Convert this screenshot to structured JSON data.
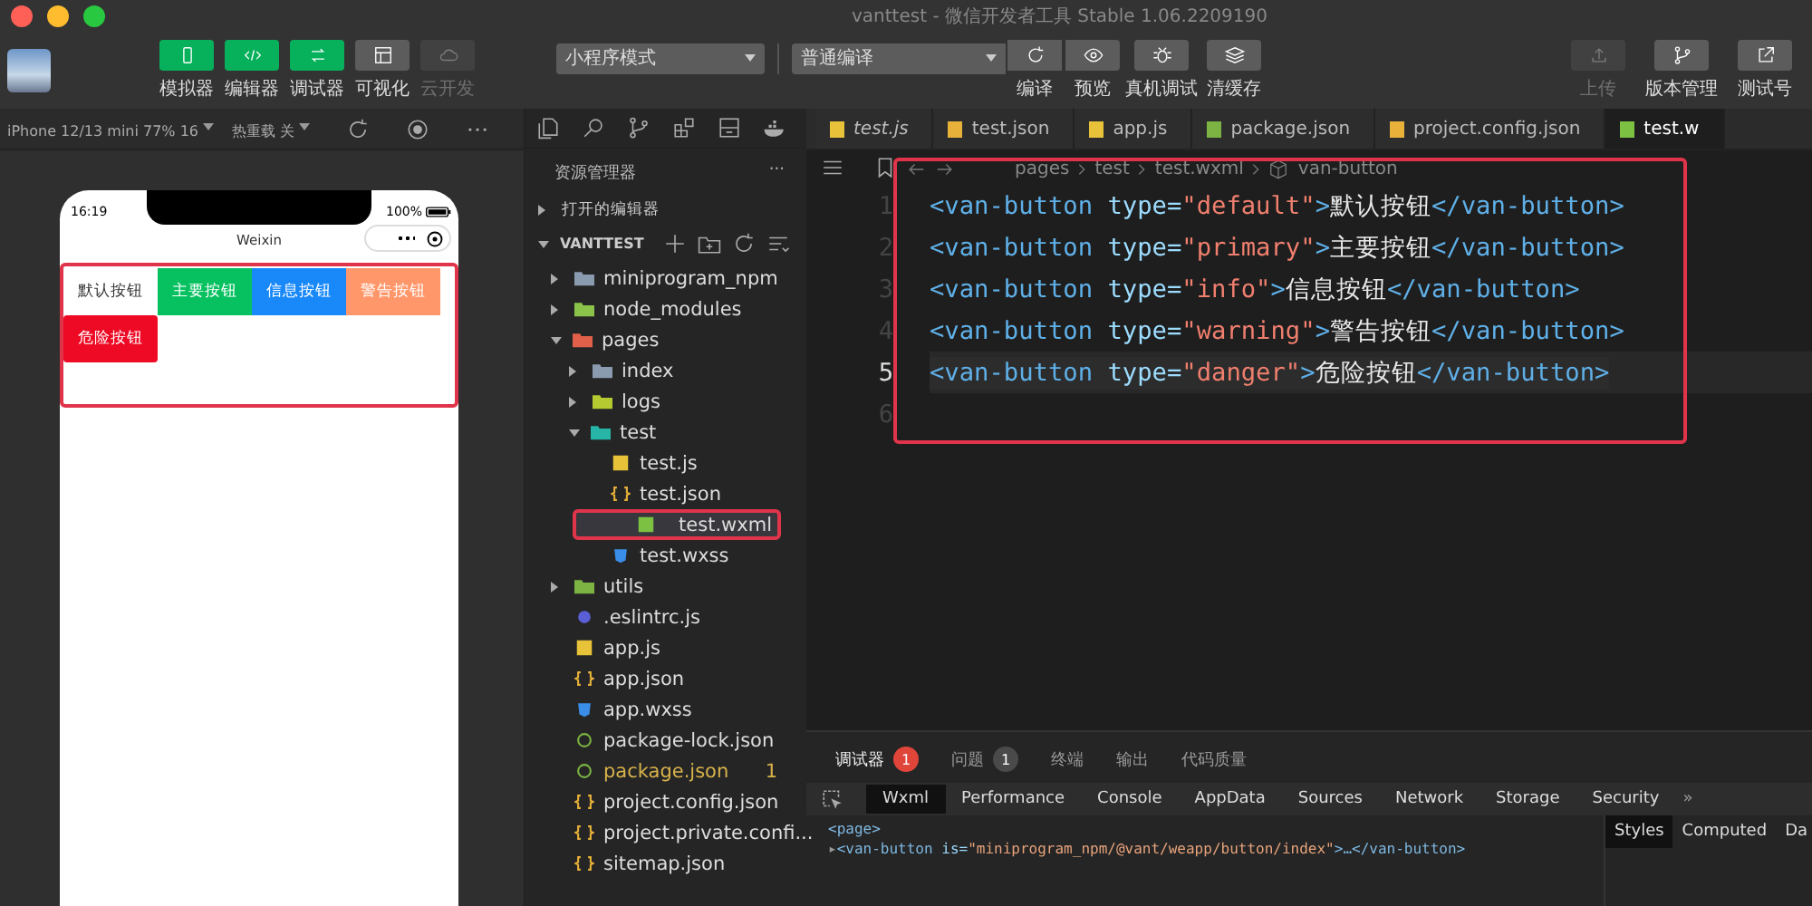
{
  "window": {
    "title": "vanttest - 微信开发者工具 Stable 1.06.2209190"
  },
  "toolbar": {
    "view_buttons": [
      {
        "label": "模拟器",
        "on": true,
        "disabled": false
      },
      {
        "label": "编辑器",
        "on": true,
        "disabled": false
      },
      {
        "label": "调试器",
        "on": true,
        "disabled": false
      },
      {
        "label": "可视化",
        "on": false,
        "disabled": false
      },
      {
        "label": "云开发",
        "on": false,
        "disabled": true
      }
    ],
    "mode_select": {
      "value": "小程序模式"
    },
    "compile_select": {
      "value": "普通编译"
    },
    "actions": [
      {
        "label": "编译"
      },
      {
        "label": "预览"
      },
      {
        "label": "真机调试"
      },
      {
        "label": "清缓存"
      }
    ],
    "right_actions": [
      {
        "label": "上传",
        "disabled": true
      },
      {
        "label": "版本管理",
        "disabled": false
      },
      {
        "label": "测试号",
        "disabled": false
      }
    ]
  },
  "simulator": {
    "device": "iPhone 12/13 mini 77% 16",
    "hot_reload": "热重载 关",
    "phone": {
      "time": "16:19",
      "battery": "100%",
      "nav_title": "Weixin",
      "buttons": [
        {
          "label": "默认按钮",
          "kind": "default"
        },
        {
          "label": "主要按钮",
          "kind": "primary"
        },
        {
          "label": "信息按钮",
          "kind": "info"
        },
        {
          "label": "警告按钮",
          "kind": "warning"
        },
        {
          "label": "危险按钮",
          "kind": "danger"
        }
      ]
    }
  },
  "explorer": {
    "title": "资源管理器",
    "more": "···",
    "sections": [
      {
        "label": "打开的编辑器",
        "expanded": false
      },
      {
        "label": "VANTTEST",
        "expanded": true
      }
    ],
    "tree": [
      {
        "name": "miniprogram_npm",
        "kind": "folder",
        "color": "#8a9bb0",
        "expanded": false,
        "selected": false,
        "modified": false
      },
      {
        "name": "node_modules",
        "kind": "folder",
        "color": "#8bc34a",
        "expanded": false,
        "selected": false,
        "modified": false
      },
      {
        "name": "pages",
        "kind": "folder",
        "color": "#e0604a",
        "expanded": true,
        "selected": false,
        "modified": false,
        "children": [
          {
            "name": "index",
            "kind": "folder",
            "color": "#8a9bb0",
            "expanded": false,
            "selected": false,
            "modified": false
          },
          {
            "name": "logs",
            "kind": "folder",
            "color": "#b5c930",
            "expanded": false,
            "selected": false,
            "modified": false
          },
          {
            "name": "test",
            "kind": "folder",
            "color": "#26b5a6",
            "expanded": true,
            "selected": false,
            "modified": false,
            "children": [
              {
                "name": "test.js",
                "kind": "js",
                "selected": false,
                "modified": false
              },
              {
                "name": "test.json",
                "kind": "json",
                "selected": false,
                "modified": false
              },
              {
                "name": "test.wxml",
                "kind": "wxml",
                "selected": true,
                "modified": false
              },
              {
                "name": "test.wxss",
                "kind": "wxss",
                "selected": false,
                "modified": false
              }
            ]
          }
        ]
      },
      {
        "name": "utils",
        "kind": "folder",
        "color": "#7cb342",
        "expanded": false,
        "selected": false,
        "modified": false
      },
      {
        "name": ".eslintrc.js",
        "kind": "eslint",
        "selected": false,
        "modified": false
      },
      {
        "name": "app.js",
        "kind": "js",
        "selected": false,
        "modified": false
      },
      {
        "name": "app.json",
        "kind": "json",
        "selected": false,
        "modified": false
      },
      {
        "name": "app.wxss",
        "kind": "wxss",
        "selected": false,
        "modified": false
      },
      {
        "name": "package-lock.json",
        "kind": "npm",
        "selected": false,
        "modified": false
      },
      {
        "name": "package.json",
        "kind": "npm",
        "selected": false,
        "modified": true,
        "badge": "1"
      },
      {
        "name": "project.config.json",
        "kind": "json",
        "selected": false,
        "modified": false
      },
      {
        "name": "project.private.confi...",
        "kind": "json",
        "selected": false,
        "modified": false
      },
      {
        "name": "sitemap.json",
        "kind": "json",
        "selected": false,
        "modified": false
      }
    ]
  },
  "editor": {
    "tabs": [
      {
        "label": "test.js",
        "kind": "js",
        "preview": true,
        "selected": false
      },
      {
        "label": "test.json",
        "kind": "json",
        "preview": false,
        "selected": false
      },
      {
        "label": "app.js",
        "kind": "js",
        "preview": false,
        "selected": false
      },
      {
        "label": "package.json",
        "kind": "npm",
        "preview": false,
        "selected": false
      },
      {
        "label": "project.config.json",
        "kind": "json",
        "preview": false,
        "selected": false
      },
      {
        "label": "test.w",
        "kind": "wxml",
        "preview": false,
        "selected": true
      }
    ],
    "breadcrumb": [
      "pages",
      "test",
      "test.wxml",
      "van-button"
    ],
    "lines": [
      {
        "number": "1",
        "active": false,
        "tokens": [
          {
            "kind": "tag",
            "text": "<van-button"
          },
          {
            "kind": "attr",
            "text": " type="
          },
          {
            "kind": "string",
            "text": "\"default\""
          },
          {
            "kind": "tag",
            "text": ">"
          },
          {
            "kind": "text",
            "text": "默认按钮"
          },
          {
            "kind": "tag",
            "text": "</van-button>"
          }
        ]
      },
      {
        "number": "2",
        "active": false,
        "tokens": [
          {
            "kind": "tag",
            "text": "<van-button"
          },
          {
            "kind": "attr",
            "text": " type="
          },
          {
            "kind": "string",
            "text": "\"primary\""
          },
          {
            "kind": "tag",
            "text": ">"
          },
          {
            "kind": "text",
            "text": "主要按钮"
          },
          {
            "kind": "tag",
            "text": "</van-button>"
          }
        ]
      },
      {
        "number": "3",
        "active": false,
        "tokens": [
          {
            "kind": "tag",
            "text": "<van-button"
          },
          {
            "kind": "attr",
            "text": " type="
          },
          {
            "kind": "string",
            "text": "\"info\""
          },
          {
            "kind": "tag",
            "text": ">"
          },
          {
            "kind": "text",
            "text": "信息按钮"
          },
          {
            "kind": "tag",
            "text": "</van-button>"
          }
        ]
      },
      {
        "number": "4",
        "active": false,
        "tokens": [
          {
            "kind": "tag",
            "text": "<van-button"
          },
          {
            "kind": "attr",
            "text": " type="
          },
          {
            "kind": "string",
            "text": "\"warning\""
          },
          {
            "kind": "tag",
            "text": ">"
          },
          {
            "kind": "text",
            "text": "警告按钮"
          },
          {
            "kind": "tag",
            "text": "</van-button>"
          }
        ]
      },
      {
        "number": "5",
        "active": true,
        "tokens": [
          {
            "kind": "tag",
            "text": "<van-button"
          },
          {
            "kind": "attr",
            "text": " type="
          },
          {
            "kind": "string",
            "text": "\"danger\""
          },
          {
            "kind": "tag",
            "text": ">"
          },
          {
            "kind": "text",
            "text": "危险按钮"
          },
          {
            "kind": "tag",
            "text": "</van-button>"
          }
        ]
      },
      {
        "number": "6",
        "active": false
      }
    ]
  },
  "bottom_panel": {
    "tabs": [
      {
        "label": "调试器",
        "selected": true,
        "badge": "1",
        "color": "#e0453a"
      },
      {
        "label": "问题",
        "selected": false,
        "badge": "1",
        "color": "#4a4a4a"
      },
      {
        "label": "终端",
        "selected": false
      },
      {
        "label": "输出",
        "selected": false
      },
      {
        "label": "代码质量",
        "selected": false
      }
    ],
    "devtools_tabs": [
      {
        "label": "Wxml",
        "selected": true
      },
      {
        "label": "Performance",
        "selected": false
      },
      {
        "label": "Console",
        "selected": false
      },
      {
        "label": "AppData",
        "selected": false
      },
      {
        "label": "Sources",
        "selected": false
      },
      {
        "label": "Network",
        "selected": false
      },
      {
        "label": "Storage",
        "selected": false
      },
      {
        "label": "Security",
        "selected": false
      }
    ],
    "more_tabs": "»",
    "wxml_lines": [
      {
        "tag": "<page>"
      },
      {
        "toggle": "▸",
        "tag": "<van-button",
        "attr": " is=",
        "value": "\"miniprogram_npm/@vant/weapp/button/index\"",
        "rest": ">…</van-button>"
      }
    ],
    "style_tabs": [
      {
        "label": "Styles",
        "selected": true
      },
      {
        "label": "Computed",
        "selected": false
      },
      {
        "label": "Da",
        "selected": false
      }
    ]
  }
}
